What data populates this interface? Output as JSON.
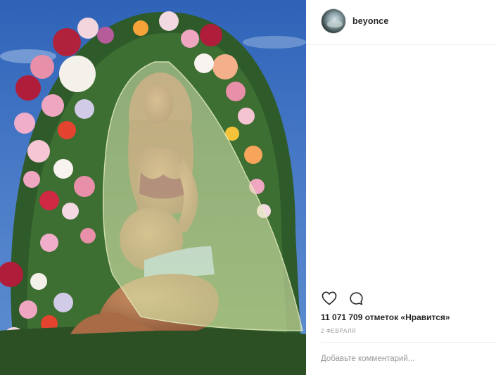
{
  "post": {
    "username": "beyonce",
    "likes_text": "11 071 709 отметок «Нравится»",
    "date_text": "2 ФЕВРАЛЯ",
    "comment_placeholder": "Добавьте комментарий..."
  },
  "icons": {
    "like": "heart-outline-icon",
    "comment": "speech-bubble-icon"
  },
  "colors": {
    "sky": "#3f6fbe",
    "text": "#262626",
    "muted": "#999999",
    "divider": "#efefef"
  }
}
